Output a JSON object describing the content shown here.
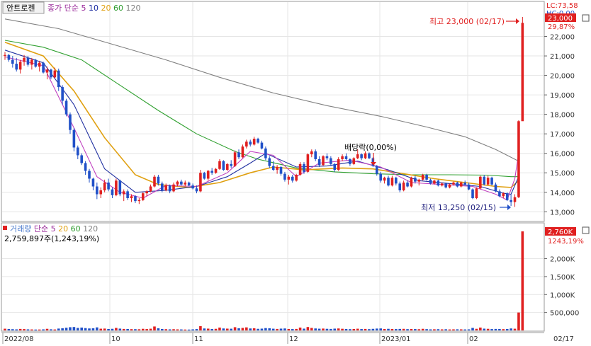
{
  "header": {
    "stock_name": "안트로젠",
    "price_legend": [
      {
        "text": "종가 단순",
        "color": "#9a2a9a"
      },
      {
        "text": "5",
        "color": "#9a2a9a"
      },
      {
        "text": "10",
        "color": "#1a2aa0"
      },
      {
        "text": "20",
        "color": "#e0a010"
      },
      {
        "text": "60",
        "color": "#2a9a2a"
      },
      {
        "text": "120",
        "color": "#808080"
      }
    ],
    "volume_legend": [
      {
        "text": "거래량",
        "color": "#4a7acc"
      },
      {
        "text": "단순",
        "color": "#9a2a9a"
      },
      {
        "text": "5",
        "color": "#9a2a9a"
      },
      {
        "text": "20",
        "color": "#e0a010"
      },
      {
        "text": "60",
        "color": "#2a9a2a"
      },
      {
        "text": "120",
        "color": "#808080"
      }
    ],
    "volume_readout": "2,759,897주(1,243,19%)"
  },
  "right_axis": {
    "lc_label": "LC:73,58",
    "hc_label": "HC:0,00",
    "price_tag": "23,000",
    "pct_tag": "29,87%",
    "volume_tag": "2,760K",
    "volume_pct_tag": "1243,19%",
    "price_ticks": [
      "22,000",
      "21,000",
      "20,000",
      "19,000",
      "18,000",
      "17,000",
      "16,000",
      "15,000",
      "14,000",
      "13,000"
    ],
    "volume_ticks": [
      "2,000K",
      "1,500K",
      "1,000K",
      "500,000"
    ]
  },
  "annotations": {
    "high": "최고 23,000 (02/17)",
    "low": "최저 13,250 (02/15)",
    "dividend": "배당락(0,00%)"
  },
  "x_axis": {
    "labels": [
      "2022/08",
      "10",
      "11",
      "12",
      "2023/01",
      "02"
    ],
    "last_label": "02/17"
  },
  "colors": {
    "up": "#e02020",
    "down": "#2050c8",
    "ma5": "#c040c0",
    "ma10": "#2030a0",
    "ma20": "#e0a010",
    "ma60": "#30a030",
    "ma120": "#808080",
    "grid": "#e6e6e6",
    "tag_bg": "#e02020"
  },
  "chart_data": {
    "type": "candlestick",
    "y_range": [
      12800,
      23200
    ],
    "volume_range": [
      0,
      2800000
    ],
    "candles": [
      [
        21000,
        21200,
        20800,
        21050
      ],
      [
        21050,
        21100,
        20700,
        20800
      ],
      [
        20800,
        21000,
        20400,
        20600
      ],
      [
        20600,
        20900,
        20200,
        20300
      ],
      [
        20300,
        20800,
        20100,
        20700
      ],
      [
        20700,
        21050,
        20500,
        20900
      ],
      [
        20900,
        21000,
        20450,
        20550
      ],
      [
        20550,
        20900,
        20300,
        20800
      ],
      [
        20800,
        20850,
        20400,
        20450
      ],
      [
        20450,
        20750,
        20200,
        20650
      ],
      [
        20650,
        20700,
        20100,
        20150
      ],
      [
        20150,
        20450,
        19800,
        20300
      ],
      [
        20300,
        20350,
        19800,
        19900
      ],
      [
        19900,
        20400,
        19850,
        20250
      ],
      [
        20250,
        20350,
        19200,
        19400
      ],
      [
        19400,
        19500,
        18500,
        18700
      ],
      [
        18700,
        18800,
        17900,
        18000
      ],
      [
        18000,
        18100,
        17000,
        17200
      ],
      [
        17200,
        17300,
        16100,
        16300
      ],
      [
        16300,
        16400,
        15700,
        15900
      ],
      [
        15900,
        16000,
        15400,
        15500
      ],
      [
        15500,
        15600,
        14900,
        15100
      ],
      [
        15100,
        15200,
        14500,
        14700
      ],
      [
        14700,
        14750,
        14100,
        14300
      ],
      [
        14300,
        14500,
        13650,
        13900
      ],
      [
        13900,
        14250,
        13700,
        14100
      ],
      [
        14100,
        14650,
        14000,
        14500
      ],
      [
        14500,
        14700,
        14050,
        14150
      ],
      [
        14150,
        14250,
        13700,
        13850
      ],
      [
        13850,
        14700,
        13800,
        14600
      ],
      [
        14600,
        14650,
        13800,
        13900
      ],
      [
        13900,
        14150,
        13550,
        14050
      ],
      [
        14050,
        14150,
        13600,
        13700
      ],
      [
        13700,
        13900,
        13500,
        13800
      ],
      [
        13800,
        13850,
        13450,
        13550
      ],
      [
        13550,
        13700,
        13400,
        13600
      ],
      [
        13600,
        14000,
        13550,
        13950
      ],
      [
        13950,
        14100,
        13800,
        14050
      ],
      [
        14050,
        14400,
        14000,
        14300
      ],
      [
        14300,
        14900,
        14250,
        14800
      ],
      [
        14800,
        14900,
        14350,
        14450
      ],
      [
        14450,
        14550,
        14000,
        14100
      ],
      [
        14100,
        14450,
        14050,
        14350
      ],
      [
        14350,
        14400,
        13950,
        14050
      ],
      [
        14050,
        14500,
        14000,
        14400
      ],
      [
        14400,
        14600,
        14300,
        14550
      ],
      [
        14550,
        14650,
        14350,
        14400
      ],
      [
        14400,
        14600,
        14300,
        14500
      ],
      [
        14500,
        14550,
        14300,
        14350
      ],
      [
        14350,
        14450,
        14150,
        14200
      ],
      [
        14200,
        14350,
        13950,
        14050
      ],
      [
        14050,
        15150,
        14000,
        15000
      ],
      [
        15000,
        15050,
        14650,
        14700
      ],
      [
        14700,
        15150,
        14600,
        15100
      ],
      [
        15100,
        15250,
        14900,
        15000
      ],
      [
        15000,
        15250,
        14950,
        15200
      ],
      [
        15200,
        15700,
        15150,
        15600
      ],
      [
        15600,
        15650,
        15100,
        15150
      ],
      [
        15150,
        15500,
        15100,
        15450
      ],
      [
        15450,
        15650,
        15250,
        15350
      ],
      [
        15350,
        16150,
        15300,
        16050
      ],
      [
        16050,
        16200,
        15700,
        15800
      ],
      [
        15800,
        16450,
        15750,
        16350
      ],
      [
        16350,
        16700,
        16250,
        16600
      ],
      [
        16600,
        16700,
        16350,
        16450
      ],
      [
        16450,
        16850,
        16400,
        16750
      ],
      [
        16750,
        16800,
        16500,
        16550
      ],
      [
        16550,
        16650,
        16200,
        16250
      ],
      [
        16250,
        16350,
        15650,
        15750
      ],
      [
        15750,
        15850,
        15250,
        15350
      ],
      [
        15350,
        15600,
        15100,
        15150
      ],
      [
        15150,
        15400,
        14950,
        15300
      ],
      [
        15300,
        15350,
        14850,
        14950
      ],
      [
        14950,
        15050,
        14550,
        14650
      ],
      [
        14650,
        14900,
        14400,
        14800
      ],
      [
        14800,
        14900,
        14500,
        14600
      ],
      [
        14600,
        14950,
        14550,
        14900
      ],
      [
        14900,
        15550,
        14850,
        15450
      ],
      [
        15450,
        15550,
        14950,
        15050
      ],
      [
        15050,
        16000,
        15000,
        15950
      ],
      [
        15950,
        16200,
        15800,
        16100
      ],
      [
        16100,
        16200,
        15600,
        15700
      ],
      [
        15700,
        15850,
        15300,
        15400
      ],
      [
        15400,
        15900,
        15350,
        15850
      ],
      [
        15850,
        16000,
        15650,
        15750
      ],
      [
        15750,
        15850,
        15350,
        15450
      ],
      [
        15450,
        15500,
        15050,
        15150
      ],
      [
        15150,
        15800,
        15100,
        15700
      ],
      [
        15700,
        15950,
        15600,
        15850
      ],
      [
        15850,
        16000,
        15650,
        15700
      ],
      [
        15700,
        15750,
        15350,
        15450
      ],
      [
        15450,
        15800,
        15400,
        15750
      ],
      [
        15750,
        16200,
        15700,
        15950
      ],
      [
        15950,
        16000,
        15650,
        15750
      ],
      [
        15750,
        16100,
        15700,
        16000
      ],
      [
        16000,
        16050,
        15700,
        15750
      ],
      [
        15750,
        15800,
        15300,
        15350
      ],
      [
        15350,
        15400,
        14850,
        14950
      ],
      [
        14950,
        15050,
        14500,
        14600
      ],
      [
        14600,
        14800,
        14450,
        14750
      ],
      [
        14750,
        14850,
        14300,
        14350
      ],
      [
        14350,
        14850,
        14300,
        14750
      ],
      [
        14750,
        14800,
        14350,
        14450
      ],
      [
        14450,
        14550,
        14000,
        14100
      ],
      [
        14100,
        14600,
        14050,
        14500
      ],
      [
        14500,
        14600,
        14250,
        14300
      ],
      [
        14300,
        14800,
        14250,
        14750
      ],
      [
        14750,
        14850,
        14450,
        14550
      ],
      [
        14550,
        14700,
        14350,
        14650
      ],
      [
        14650,
        14950,
        14600,
        14900
      ],
      [
        14900,
        14950,
        14600,
        14650
      ],
      [
        14650,
        14700,
        14400,
        14450
      ],
      [
        14450,
        14650,
        14400,
        14600
      ],
      [
        14600,
        14650,
        14300,
        14350
      ],
      [
        14350,
        14500,
        14300,
        14450
      ],
      [
        14450,
        14500,
        14200,
        14250
      ],
      [
        14250,
        14450,
        14200,
        14400
      ],
      [
        14400,
        14550,
        14350,
        14500
      ],
      [
        14500,
        14550,
        14250,
        14300
      ],
      [
        14300,
        14550,
        14250,
        14500
      ],
      [
        14500,
        14600,
        14350,
        14400
      ],
      [
        14400,
        14500,
        14100,
        14150
      ],
      [
        14150,
        14200,
        13650,
        13700
      ],
      [
        13700,
        14250,
        13650,
        14200
      ],
      [
        14200,
        14850,
        14150,
        14800
      ],
      [
        14800,
        14900,
        14350,
        14400
      ],
      [
        14400,
        14850,
        14350,
        14750
      ],
      [
        14750,
        14800,
        14350,
        14400
      ],
      [
        14400,
        14500,
        14000,
        14050
      ],
      [
        14050,
        14150,
        13750,
        13800
      ],
      [
        13800,
        14000,
        13700,
        13950
      ],
      [
        13950,
        14000,
        13550,
        13600
      ],
      [
        13600,
        13900,
        13300,
        13500
      ],
      [
        13500,
        13900,
        13250,
        13750
      ],
      [
        13750,
        17700,
        13700,
        17650
      ],
      [
        17650,
        23000,
        19600,
        22700
      ]
    ],
    "volume": [
      48000,
      40000,
      35000,
      30000,
      42000,
      38000,
      30000,
      28000,
      25000,
      26000,
      30000,
      45000,
      32000,
      27000,
      52000,
      60000,
      75000,
      90000,
      95000,
      70000,
      80000,
      65000,
      55000,
      60000,
      85000,
      48000,
      52000,
      40000,
      45000,
      70000,
      50000,
      42000,
      40000,
      36000,
      35000,
      33000,
      45000,
      38000,
      48000,
      110000,
      60000,
      40000,
      35000,
      30000,
      34000,
      30000,
      28000,
      25000,
      24000,
      30000,
      38000,
      120000,
      55000,
      50000,
      40000,
      45000,
      80000,
      55000,
      50000,
      48000,
      90000,
      60000,
      70000,
      85000,
      55000,
      60000,
      45000,
      50000,
      65000,
      60000,
      48000,
      42000,
      50000,
      55000,
      40000,
      38000,
      42000,
      80000,
      50000,
      95000,
      70000,
      55000,
      48000,
      52000,
      45000,
      42000,
      50000,
      55000,
      46000,
      40000,
      36000,
      40000,
      48000,
      38000,
      42000,
      36000,
      44000,
      52000,
      55000,
      40000,
      45000,
      40000,
      38000,
      42000,
      44000,
      36000,
      40000,
      38000,
      34000,
      45000,
      36000,
      30000,
      32000,
      35000,
      30000,
      33000,
      28000,
      30000,
      32000,
      30000,
      28000,
      30000,
      70000,
      45000,
      80000,
      50000,
      45000,
      38000,
      42000,
      40000,
      36000,
      40000,
      55000,
      48000,
      500000,
      2759897
    ],
    "ma5": [
      [
        0,
        20950
      ],
      [
        10,
        20500
      ],
      [
        18,
        17300
      ],
      [
        24,
        14800
      ],
      [
        30,
        14000
      ],
      [
        36,
        13700
      ],
      [
        42,
        14350
      ],
      [
        50,
        14300
      ],
      [
        58,
        15000
      ],
      [
        64,
        16100
      ],
      [
        70,
        15900
      ],
      [
        76,
        14800
      ],
      [
        82,
        15500
      ],
      [
        90,
        15650
      ],
      [
        98,
        15300
      ],
      [
        106,
        14500
      ],
      [
        114,
        14400
      ],
      [
        122,
        14300
      ],
      [
        128,
        13900
      ],
      [
        131,
        13600
      ],
      [
        133,
        14700
      ],
      [
        134,
        16000
      ]
    ],
    "ma10": [
      [
        0,
        21300
      ],
      [
        10,
        20650
      ],
      [
        18,
        18500
      ],
      [
        26,
        15200
      ],
      [
        34,
        14000
      ],
      [
        42,
        14100
      ],
      [
        50,
        14300
      ],
      [
        58,
        14800
      ],
      [
        64,
        15500
      ],
      [
        68,
        16000
      ],
      [
        76,
        15300
      ],
      [
        84,
        15350
      ],
      [
        92,
        15600
      ],
      [
        100,
        15150
      ],
      [
        108,
        14600
      ],
      [
        116,
        14450
      ],
      [
        124,
        14300
      ],
      [
        130,
        13950
      ],
      [
        132,
        13900
      ],
      [
        134,
        14800
      ]
    ],
    "ma20": [
      [
        0,
        21700
      ],
      [
        10,
        21000
      ],
      [
        18,
        19200
      ],
      [
        26,
        16800
      ],
      [
        34,
        14900
      ],
      [
        40,
        14400
      ],
      [
        48,
        14250
      ],
      [
        56,
        14500
      ],
      [
        64,
        15000
      ],
      [
        70,
        15300
      ],
      [
        78,
        15150
      ],
      [
        88,
        15250
      ],
      [
        96,
        15200
      ],
      [
        104,
        14950
      ],
      [
        112,
        14700
      ],
      [
        120,
        14500
      ],
      [
        128,
        14300
      ],
      [
        132,
        14250
      ],
      [
        134,
        14600
      ]
    ],
    "ma60": [
      [
        0,
        21800
      ],
      [
        10,
        21450
      ],
      [
        20,
        20800
      ],
      [
        30,
        19500
      ],
      [
        40,
        18200
      ],
      [
        50,
        17000
      ],
      [
        60,
        16100
      ],
      [
        66,
        15700
      ],
      [
        76,
        15250
      ],
      [
        86,
        15050
      ],
      [
        96,
        14950
      ],
      [
        106,
        14900
      ],
      [
        116,
        14900
      ],
      [
        126,
        14880
      ],
      [
        132,
        14800
      ],
      [
        134,
        14800
      ]
    ],
    "ma120": [
      [
        0,
        22900
      ],
      [
        14,
        22400
      ],
      [
        28,
        21600
      ],
      [
        42,
        20800
      ],
      [
        56,
        19900
      ],
      [
        70,
        19100
      ],
      [
        84,
        18450
      ],
      [
        98,
        17900
      ],
      [
        110,
        17350
      ],
      [
        120,
        16850
      ],
      [
        128,
        16200
      ],
      [
        134,
        15600
      ]
    ]
  }
}
